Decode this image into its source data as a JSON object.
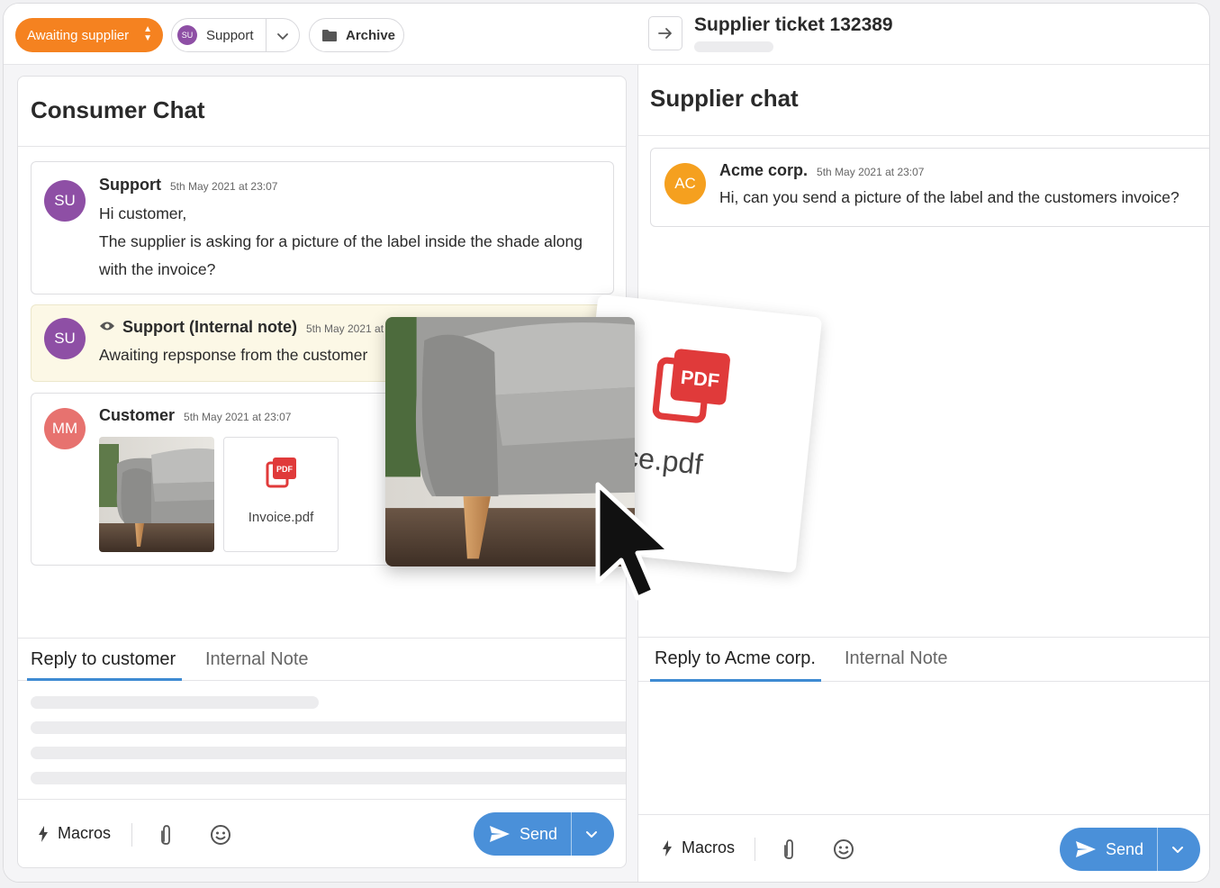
{
  "colors": {
    "accent_orange": "#f58220",
    "accent_blue": "#4a90d9",
    "note_bg": "#fcf8e6",
    "support_avatar": "#8e4fa5",
    "customer_avatar": "#e7726f",
    "supplier_avatar": "#f5a01f",
    "pdf_red": "#e03a3a"
  },
  "toolbar": {
    "status": "Awaiting supplier",
    "assignee_initials": "SU",
    "assignee": "Support",
    "archive": "Archive"
  },
  "consumer": {
    "title": "Consumer Chat",
    "messages": [
      {
        "initials": "SU",
        "author": "Support",
        "time": "5th May 2021 at 23:07",
        "lines": [
          "Hi customer,",
          "The supplier is asking for a picture of the label inside the shade along",
          "with the invoice?"
        ]
      },
      {
        "initials": "SU",
        "author": "Support (Internal note)",
        "time": "5th May 2021 at 23:07",
        "text": "Awaiting repsponse from the customer"
      },
      {
        "initials": "MM",
        "author": "Customer",
        "time": "5th May 2021 at 23:07",
        "attachment_name": "Invoice.pdf"
      }
    ],
    "tabs": [
      "Reply to customer",
      "Internal Note"
    ],
    "macros": "Macros",
    "send": "Send"
  },
  "supplier": {
    "ticket_title": "Supplier ticket 132389",
    "title": "Supplier chat",
    "message": {
      "initials": "AC",
      "author": "Acme corp.",
      "time": "5th May 2021 at 23:07",
      "text": "Hi, can you send a picture of the label and the customers invoice?"
    },
    "tabs": [
      "Reply to Acme corp.",
      "Internal Note"
    ],
    "macros": "Macros",
    "send": "Send"
  },
  "drag_preview": {
    "filename": "Invoice.pdf",
    "badge": "PDF"
  },
  "icons": [
    "chevron-up-down-icon",
    "chevron-down-icon",
    "folder-icon",
    "arrow-right-icon",
    "eye-icon",
    "bolt-icon",
    "paperclip-icon",
    "smiley-icon",
    "send-icon",
    "pdf-icon",
    "cursor-icon"
  ]
}
